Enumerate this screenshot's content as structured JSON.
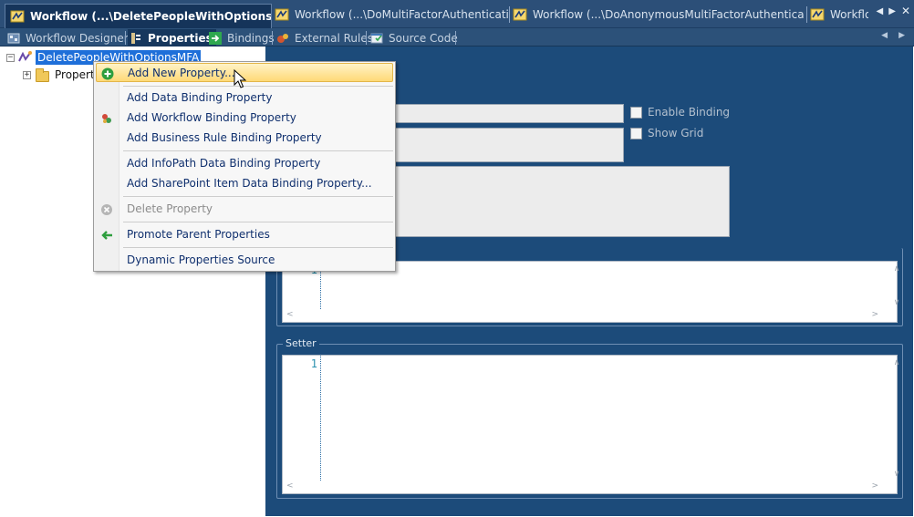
{
  "colors": {
    "tab_strip": "#2c4f78",
    "active_tab": "#15345a",
    "editor_background": "#1c4b7a",
    "selection": "#1e6fd9",
    "menu_hover": "#ffd977",
    "menu_text": "#10306e"
  },
  "document_tabs": [
    {
      "label": "Workflow (...\\DeletePeopleWithOptionsMFA)",
      "icon": "workflow-icon",
      "active": true
    },
    {
      "label": "Workflow (...\\DoMultiFactorAuthentication)",
      "icon": "workflow-icon",
      "active": false
    },
    {
      "label": "Workflow (...\\DoAnonymousMultiFactorAuthentication)",
      "icon": "workflow-icon",
      "active": false
    },
    {
      "label": "Workflo",
      "icon": "workflow-icon",
      "active": false
    }
  ],
  "sub_tabs": [
    {
      "label": "Workflow Designer",
      "icon": "designer-icon",
      "active": false
    },
    {
      "label": "Properties",
      "icon": "properties-icon",
      "active": true
    },
    {
      "label": "Bindings",
      "icon": "bindings-icon",
      "active": false
    },
    {
      "label": "External Rules",
      "icon": "rules-icon",
      "active": false
    },
    {
      "label": "Source Code",
      "icon": "source-code-icon",
      "active": false
    }
  ],
  "tree": {
    "root_label": "DeletePeopleWithOptionsMFA",
    "child_label": "Propert"
  },
  "editor": {
    "enable_binding_label": "Enable Binding",
    "show_grid_label": "Show Grid",
    "getter_line_number": "1",
    "setter_title": "Setter",
    "setter_line_number": "1"
  },
  "context_menu": {
    "items": [
      {
        "label": "Add New Property...",
        "icon": "add-icon",
        "state": "hover"
      },
      {
        "label": "Add Data Binding Property",
        "icon": "",
        "state": "normal"
      },
      {
        "label": "Add Workflow Binding Property",
        "icon": "workflow-binding-icon",
        "state": "normal"
      },
      {
        "label": "Add Business Rule Binding Property",
        "icon": "",
        "state": "normal"
      },
      {
        "label": "Add InfoPath Data Binding Property",
        "icon": "",
        "state": "normal"
      },
      {
        "label": "Add SharePoint Item Data Binding Property...",
        "icon": "",
        "state": "normal"
      },
      {
        "label": "Delete Property",
        "icon": "delete-icon",
        "state": "disabled"
      },
      {
        "label": "Promote Parent Properties",
        "icon": "promote-arrow-icon",
        "state": "normal"
      },
      {
        "label": "Dynamic Properties Source",
        "icon": "",
        "state": "normal"
      }
    ]
  }
}
